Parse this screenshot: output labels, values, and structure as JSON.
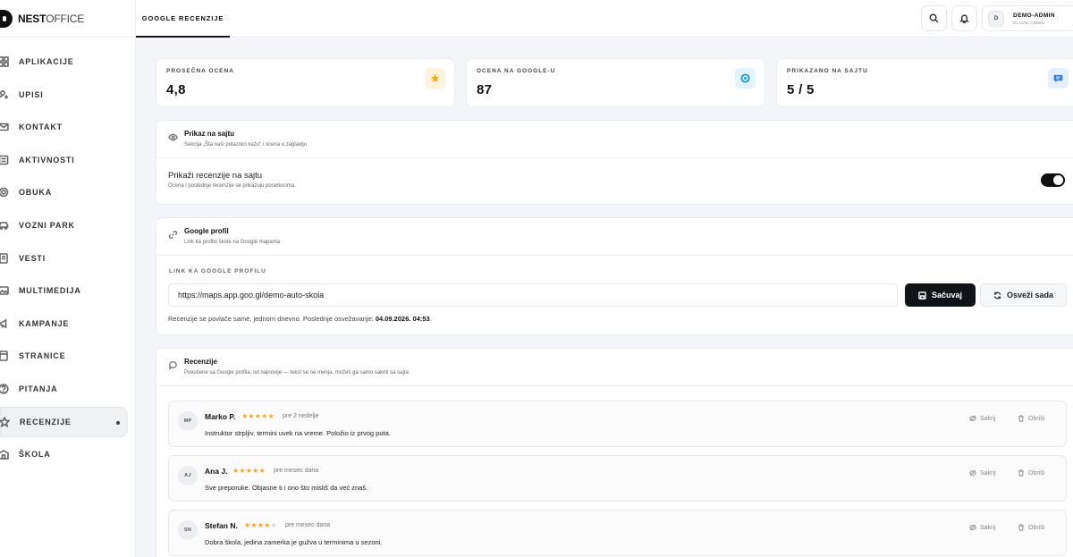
{
  "app": {
    "logo_bold": "NEST",
    "logo_light": "OFFICE"
  },
  "sidebar": {
    "items": [
      {
        "label": "APLIKACIJE",
        "icon": "grid-icon"
      },
      {
        "label": "UPISI",
        "icon": "user-plus-icon"
      },
      {
        "label": "KONTAKT",
        "icon": "mail-icon"
      },
      {
        "label": "AKTIVNOSTI",
        "icon": "list-icon"
      },
      {
        "label": "OBUKA",
        "icon": "target-icon"
      },
      {
        "label": "VOZNI PARK",
        "icon": "car-icon"
      },
      {
        "label": "VESTI",
        "icon": "document-icon"
      },
      {
        "label": "MULTIMEDIJA",
        "icon": "image-icon"
      },
      {
        "label": "KAMPANJE",
        "icon": "megaphone-icon"
      },
      {
        "label": "STRANICE",
        "icon": "page-icon"
      },
      {
        "label": "PITANJA",
        "icon": "question-icon"
      },
      {
        "label": "RECENZIJE",
        "icon": "star-icon",
        "active": true
      },
      {
        "label": "ŠKOLA",
        "icon": "school-icon"
      }
    ]
  },
  "topbar": {
    "active_tab": "GOOGLE RECENZIJE",
    "user_initial": "D",
    "user_name": "DEMO-ADMIN",
    "user_role": "GLAVNI ADMIN"
  },
  "stats": [
    {
      "label": "PROSEČNA OCENA",
      "value": "4,8",
      "icon": "star-icon",
      "color": "#f2a623",
      "bg": "#fdf3dd"
    },
    {
      "label": "OCENA NA GOOGLE-U",
      "value": "87",
      "icon": "google-icon",
      "color": "#1a9bd7",
      "bg": "#e4f3fb"
    },
    {
      "label": "PRIKAZANO NA SAJTU",
      "value": "5 / 5",
      "icon": "chat-icon",
      "color": "#3b7ddd",
      "bg": "#e6effb"
    }
  ],
  "display_card": {
    "title": "Prikaz na sajtu",
    "subtitle": "Sekcija „Šta naši polaznici kažu“ i ocena u zaglavlju",
    "toggle_title": "Prikaži recenzije na sajtu",
    "toggle_subtitle": "Ocena i poslednje recenzije se prikazuju posetiocima.",
    "toggle_on": true
  },
  "profile_card": {
    "title": "Google profil",
    "subtitle": "Link ka profilu škole na Google mapama",
    "field_label": "LINK KA GOOGLE PROFILU",
    "url": "https://maps.app.goo.gl/demo-auto-skola",
    "save_label": "Sačuvaj",
    "refresh_label": "Osveži sada",
    "sync_text": "Recenzije se povlače same, jednom dnevno. Poslednje osvežavanje:",
    "sync_time": "04.09.2026. 04:53",
    "sync_end": "."
  },
  "reviews_card": {
    "title": "Recenzije",
    "subtitle": "Povučene sa Google profila, od najnovije — tekst se ne menja, možeš ga samo sakriti sa sajta",
    "hide_label": "Sakrij",
    "delete_label": "Obriši",
    "items": [
      {
        "initials": "MP",
        "name": "Marko P.",
        "stars": 5,
        "time": "pre 2 nedelje",
        "text": "Instruktor strpljiv, termini uvek na vreme. Položio iz prvog puta."
      },
      {
        "initials": "AJ",
        "name": "Ana J.",
        "stars": 5,
        "time": "pre mesec dana",
        "text": "Sve preporuke. Objasne ti i ono što misliš da već znaš."
      },
      {
        "initials": "SN",
        "name": "Stefan N.",
        "stars": 4,
        "time": "pre mesec dana",
        "text": "Dobra škola, jedina zamerka je gužva u terminima u sezoni."
      }
    ]
  }
}
